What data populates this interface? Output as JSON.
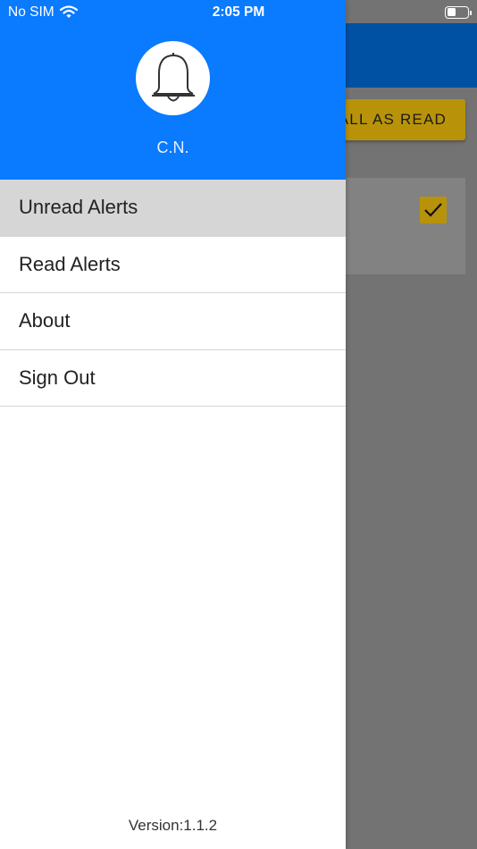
{
  "status_bar": {
    "carrier": "No SIM",
    "time": "2:05 PM",
    "battery_level": 0.45
  },
  "background": {
    "mark_all_read_label": "ALL AS READ",
    "checkbox_checked": true,
    "colors": {
      "header": "#0050a3",
      "button": "#b8930a",
      "overlay": "#737373"
    }
  },
  "drawer": {
    "user_initials": "C.N.",
    "avatar_icon": "bell-icon",
    "menu": [
      {
        "label": "Unread Alerts",
        "active": true
      },
      {
        "label": "Read Alerts",
        "active": false
      },
      {
        "label": "About",
        "active": false
      },
      {
        "label": "Sign Out",
        "active": false
      }
    ],
    "version": "Version:1.1.2",
    "colors": {
      "header": "#0a7aff",
      "active_item": "#d6d6d6"
    }
  }
}
